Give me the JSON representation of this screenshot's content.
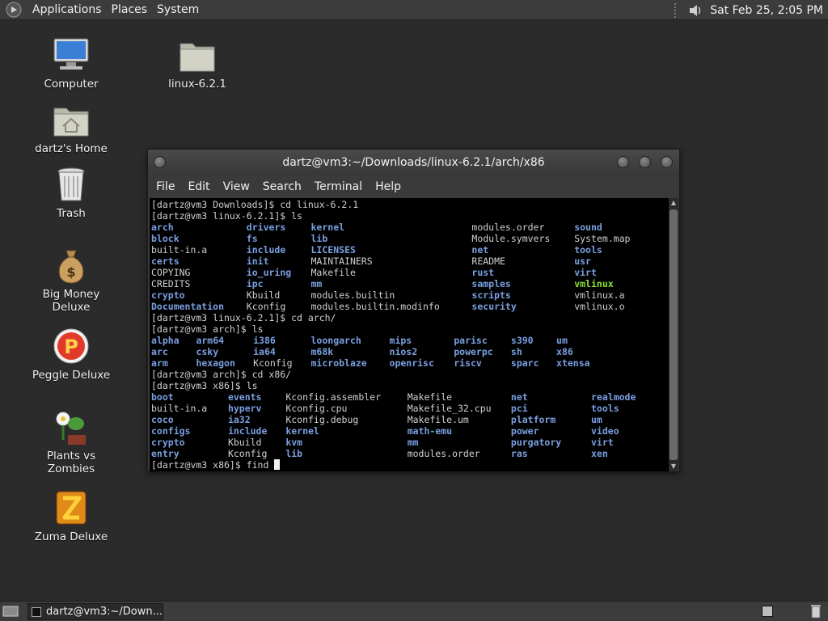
{
  "top_panel": {
    "menus": [
      "Applications",
      "Places",
      "System"
    ],
    "clock": "Sat Feb 25,  2:05 PM",
    "icons": [
      "gnome-foot-icon",
      "volume-icon"
    ]
  },
  "desktop": {
    "icons": [
      {
        "label": "Computer",
        "icon": "computer-icon"
      },
      {
        "label": "linux-6.2.1",
        "icon": "folder-icon"
      },
      {
        "label": "dartz's Home",
        "icon": "home-folder-icon"
      },
      {
        "label": "Trash",
        "icon": "trash-icon"
      },
      {
        "label": "Big Money Deluxe",
        "icon": "money-bag-icon"
      },
      {
        "label": "Peggle Deluxe",
        "icon": "peggle-icon"
      },
      {
        "label": "Plants vs Zombies",
        "icon": "plant-icon"
      },
      {
        "label": "Zuma Deluxe",
        "icon": "zuma-icon"
      }
    ]
  },
  "terminal": {
    "title": "dartz@vm3:~/Downloads/linux-6.2.1/arch/x86",
    "menu": [
      "File",
      "Edit",
      "View",
      "Search",
      "Terminal",
      "Help"
    ],
    "lines": [
      "[dartz@vm3 Downloads]$ cd linux-6.2.1",
      "[dartz@vm3 linux-6.2.1]$ ls",
      "[dartz@vm3 linux-6.2.1]$ cd arch/",
      "[dartz@vm3 arch]$ ls",
      "[dartz@vm3 arch]$ cd x86/",
      "[dartz@vm3 x86]$ ls",
      "[dartz@vm3 x86]$ find "
    ],
    "ls_linux": [
      [
        "arch",
        "drivers",
        "kernel",
        "modules.order",
        "sound"
      ],
      [
        "block",
        "fs",
        "lib",
        "Module.symvers",
        "System.map"
      ],
      [
        "built-in.a",
        "include",
        "LICENSES",
        "net",
        "tools"
      ],
      [
        "certs",
        "init",
        "MAINTAINERS",
        "README",
        "usr"
      ],
      [
        "COPYING",
        "io_uring",
        "Makefile",
        "rust",
        "virt"
      ],
      [
        "CREDITS",
        "ipc",
        "mm",
        "samples",
        "vmlinux"
      ],
      [
        "crypto",
        "Kbuild",
        "modules.builtin",
        "scripts",
        "vmlinux.a"
      ],
      [
        "Documentation",
        "Kconfig",
        "modules.builtin.modinfo",
        "security",
        "vmlinux.o"
      ]
    ],
    "ls_linux_types": [
      [
        "d",
        "d",
        "d",
        "f",
        "d"
      ],
      [
        "d",
        "d",
        "d",
        "f",
        "f"
      ],
      [
        "f",
        "d",
        "d",
        "d",
        "d"
      ],
      [
        "d",
        "d",
        "f",
        "f",
        "d"
      ],
      [
        "f",
        "d",
        "f",
        "d",
        "d"
      ],
      [
        "f",
        "d",
        "d",
        "d",
        "x"
      ],
      [
        "d",
        "f",
        "f",
        "d",
        "f"
      ],
      [
        "d",
        "f",
        "f",
        "d",
        "f"
      ]
    ],
    "ls_arch": [
      [
        "alpha",
        "arm64",
        "i386",
        "loongarch",
        "mips",
        "parisc",
        "s390",
        "um"
      ],
      [
        "arc",
        "csky",
        "ia64",
        "m68k",
        "nios2",
        "powerpc",
        "sh",
        "x86"
      ],
      [
        "arm",
        "hexagon",
        "Kconfig",
        "microblaze",
        "openrisc",
        "riscv",
        "sparc",
        "xtensa"
      ]
    ],
    "ls_arch_types": [
      [
        "d",
        "d",
        "d",
        "d",
        "d",
        "d",
        "d",
        "d"
      ],
      [
        "d",
        "d",
        "d",
        "d",
        "d",
        "d",
        "d",
        "d"
      ],
      [
        "d",
        "d",
        "f",
        "d",
        "d",
        "d",
        "d",
        "d"
      ]
    ],
    "ls_x86": [
      [
        "boot",
        "events",
        "Kconfig.assembler",
        "Makefile",
        "net",
        "realmode"
      ],
      [
        "built-in.a",
        "hyperv",
        "Kconfig.cpu",
        "Makefile_32.cpu",
        "pci",
        "tools"
      ],
      [
        "coco",
        "ia32",
        "Kconfig.debug",
        "Makefile.um",
        "platform",
        "um"
      ],
      [
        "configs",
        "include",
        "kernel",
        "math-emu",
        "power",
        "video"
      ],
      [
        "crypto",
        "Kbuild",
        "kvm",
        "mm",
        "purgatory",
        "virt"
      ],
      [
        "entry",
        "Kconfig",
        "lib",
        "modules.order",
        "ras",
        "xen"
      ]
    ],
    "ls_x86_types": [
      [
        "d",
        "d",
        "f",
        "f",
        "d",
        "d"
      ],
      [
        "f",
        "d",
        "f",
        "f",
        "d",
        "d"
      ],
      [
        "d",
        "d",
        "f",
        "f",
        "d",
        "d"
      ],
      [
        "d",
        "d",
        "d",
        "d",
        "d",
        "d"
      ],
      [
        "d",
        "f",
        "d",
        "d",
        "d",
        "d"
      ],
      [
        "d",
        "f",
        "d",
        "f",
        "d",
        "d"
      ]
    ]
  },
  "bottom_panel": {
    "task_label": "dartz@vm3:~/Down..."
  },
  "colors": {
    "directory": "#7a9fe0",
    "executable": "#8ae234",
    "plain": "#d0d0d0",
    "terminal_bg": "#000000"
  }
}
